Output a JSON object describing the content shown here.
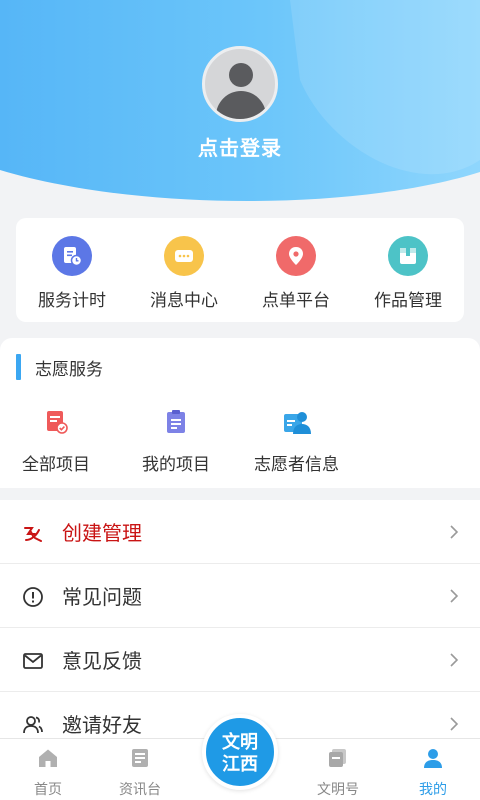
{
  "header": {
    "login_text": "点击登录",
    "gradient_start": "#56b6f7",
    "gradient_end": "#b6e5ff"
  },
  "quick_actions": [
    {
      "label": "服务计时",
      "icon": "service-timer-icon",
      "color": "#5c77e6"
    },
    {
      "label": "消息中心",
      "icon": "message-icon",
      "color": "#f8c44b"
    },
    {
      "label": "点单平台",
      "icon": "location-pin-icon",
      "color": "#f06a6a"
    },
    {
      "label": "作品管理",
      "icon": "works-box-icon",
      "color": "#4dc3c7"
    }
  ],
  "volunteer": {
    "title": "志愿服务",
    "items": [
      {
        "label": "全部项目",
        "icon": "all-projects-icon",
        "color": "#ef5a5a"
      },
      {
        "label": "我的项目",
        "icon": "my-projects-icon",
        "color": "#7d82e6"
      },
      {
        "label": "志愿者信息",
        "icon": "volunteer-info-icon",
        "color": "#3aa6e8"
      }
    ]
  },
  "menu": [
    {
      "label": "创建管理",
      "icon": "create-manage-icon",
      "color": "#c91414"
    },
    {
      "label": "常见问题",
      "icon": "info-circle-icon",
      "color": "#333333"
    },
    {
      "label": "意见反馈",
      "icon": "mail-icon",
      "color": "#333333"
    },
    {
      "label": "邀请好友",
      "icon": "friends-icon",
      "color": "#333333"
    }
  ],
  "nav": {
    "items": [
      {
        "label": "首页",
        "icon": "home-icon"
      },
      {
        "label": "资讯台",
        "icon": "news-icon"
      },
      {
        "label": "文明号",
        "icon": "civilization-icon"
      },
      {
        "label": "我的",
        "icon": "profile-icon"
      }
    ],
    "center_logo": [
      "文明",
      "江西"
    ],
    "active_color": "#2d9de8",
    "inactive_color": "#b0b0b0"
  }
}
